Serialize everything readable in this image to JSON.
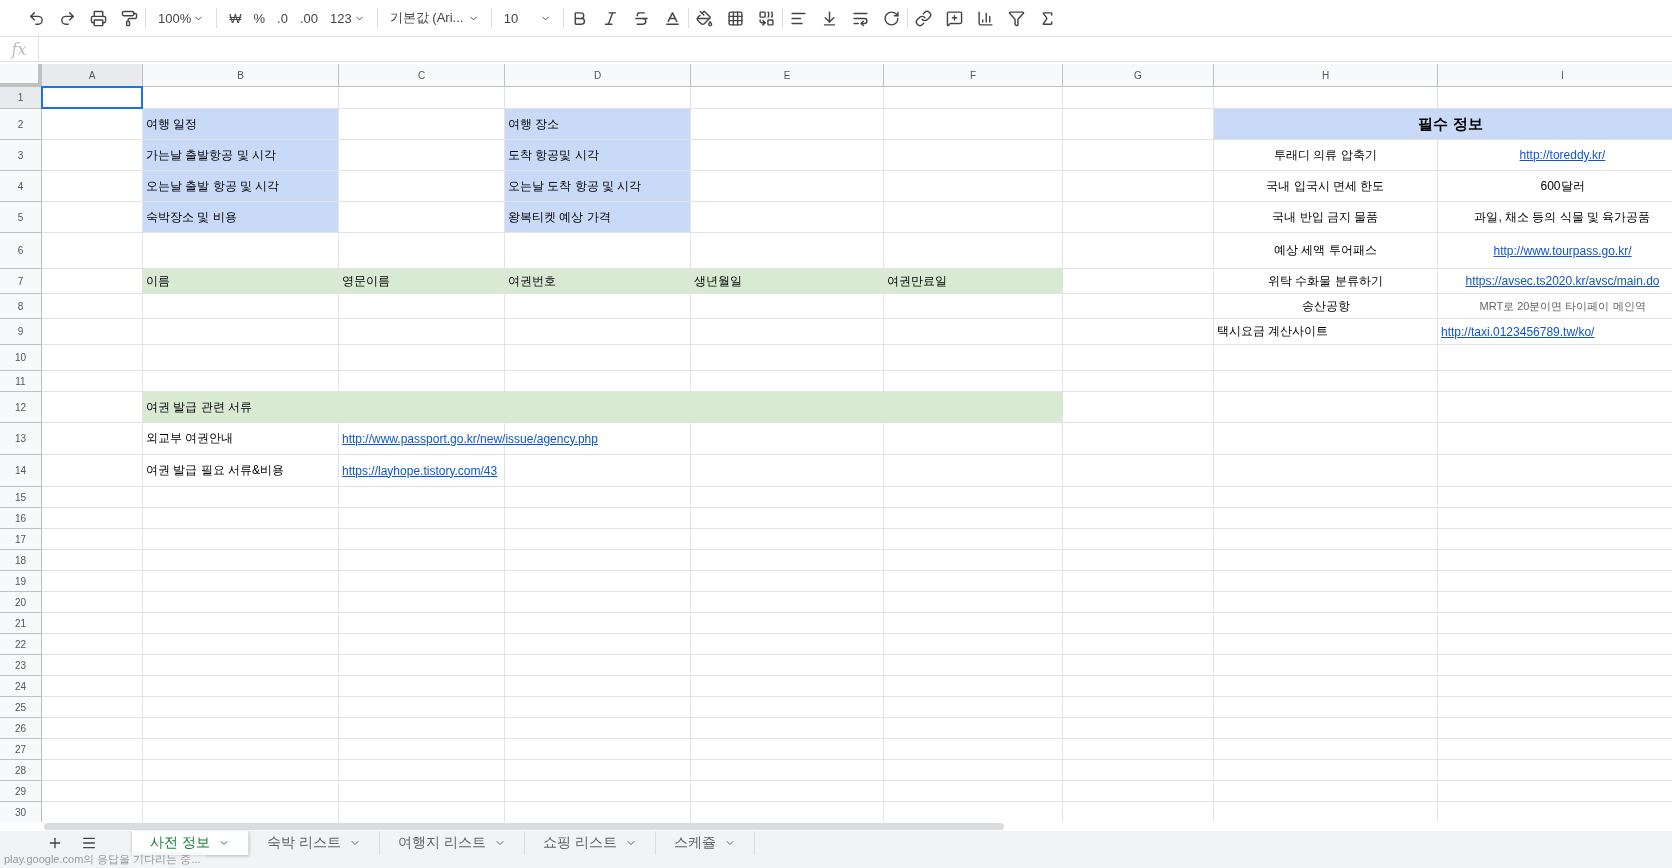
{
  "toolbar": {
    "zoom": "100%",
    "currency": "₩",
    "percent": "%",
    "decimal_less": ".0",
    "decimal_more": ".00",
    "number_format": "123",
    "font": "기본값 (Ari...",
    "font_size": "10"
  },
  "formula_bar": {
    "label": "fx"
  },
  "columns": [
    {
      "label": "A",
      "selected": true
    },
    {
      "label": "B",
      "selected": false
    },
    {
      "label": "C",
      "selected": false
    },
    {
      "label": "D",
      "selected": false
    },
    {
      "label": "E",
      "selected": false
    },
    {
      "label": "F",
      "selected": false
    },
    {
      "label": "G",
      "selected": false
    },
    {
      "label": "H",
      "selected": false
    },
    {
      "label": "I",
      "selected": false
    }
  ],
  "rows": [
    {
      "number": "1",
      "selected": true,
      "cells": {}
    },
    {
      "number": "2",
      "selected": false,
      "cells": {
        "b": {
          "text": "여행 일정",
          "color": "#c9daf8"
        },
        "d": {
          "text": "여행 장소",
          "color": "#c9daf8"
        },
        "h": {
          "text": "필수 정보",
          "color": "#c9daf8",
          "kind": "title",
          "centered": true
        },
        "i": {
          "kind": "covered",
          "color": "#c9daf8"
        }
      }
    },
    {
      "number": "3",
      "selected": false,
      "cells": {
        "b": {
          "text": "가는날 출발항공 및 시각",
          "color": "#c9daf8"
        },
        "d": {
          "text": "도착 항공및 시각",
          "color": "#c9daf8"
        },
        "h": {
          "text": "투래디 의류 압축기",
          "centered": true
        },
        "i": {
          "text": "http://toreddy.kr/",
          "kind": "link",
          "centered": true
        }
      }
    },
    {
      "number": "4",
      "selected": false,
      "cells": {
        "b": {
          "text": "오는날 출발 항공 및 시각",
          "color": "#c9daf8"
        },
        "d": {
          "text": "오는날 도착 항공 및 시각",
          "color": "#c9daf8"
        },
        "h": {
          "text": "국내 입국시 면세 한도",
          "centered": true
        },
        "i": {
          "text": "600달러",
          "centered": true
        }
      }
    },
    {
      "number": "5",
      "selected": false,
      "cells": {
        "b": {
          "text": "숙박장소 및 비용",
          "color": "#c9daf8"
        },
        "d": {
          "text": "왕복티켓 예상 가격",
          "color": "#c9daf8"
        },
        "h": {
          "text": "국내 반입 금지 물품",
          "centered": true
        },
        "i": {
          "text": "과일, 채소 등의 식물 및 육가공품",
          "centered": true
        }
      }
    },
    {
      "number": "6",
      "selected": false,
      "cells": {
        "h": {
          "text": "예상 세액 투어패스",
          "centered": true
        },
        "i": {
          "text": "http://www.tourpass.go.kr/",
          "kind": "link",
          "centered": true
        }
      }
    },
    {
      "number": "7",
      "selected": false,
      "cells": {
        "b": {
          "text": "이름",
          "color": "#d9ead3"
        },
        "c": {
          "text": "영문이름",
          "color": "#d9ead3"
        },
        "d": {
          "text": "여권번호",
          "color": "#d9ead3"
        },
        "e": {
          "text": "생년월일",
          "color": "#d9ead3"
        },
        "f": {
          "text": "여권만료일",
          "color": "#d9ead3"
        },
        "h": {
          "text": "위탁 수화물 분류하기",
          "centered": true
        },
        "i": {
          "text": "https://avsec.ts2020.kr/avsc/main.do",
          "kind": "link",
          "centered": true
        }
      }
    },
    {
      "number": "8",
      "selected": false,
      "cells": {
        "h": {
          "text": "송산공항",
          "centered": true
        },
        "i": {
          "text": "MRT로 20분이면 타이페이 메인역",
          "kind": "note",
          "centered": true
        }
      }
    },
    {
      "number": "9",
      "selected": false,
      "cells": {
        "h": {
          "text": "택시요금 계산사이트",
          "centered": false
        },
        "i": {
          "text": "http://taxi.0123456789.tw/ko/",
          "kind": "link",
          "centered": false
        }
      }
    },
    {
      "number": "10",
      "selected": false,
      "cells": {}
    },
    {
      "number": "11",
      "selected": false,
      "cells": {}
    },
    {
      "number": "12",
      "selected": false,
      "cells": {
        "b": {
          "text": "여권 발급 관련 서류",
          "color": "#d9ead3"
        },
        "c": {
          "kind": "covered",
          "color": "#d9ead3"
        },
        "d": {
          "kind": "covered",
          "color": "#d9ead3"
        },
        "e": {
          "kind": "covered",
          "color": "#d9ead3"
        },
        "f": {
          "kind": "covered",
          "color": "#d9ead3"
        }
      }
    },
    {
      "number": "13",
      "selected": false,
      "cells": {
        "b": {
          "text": "외교부 여권안내"
        },
        "c": {
          "text": "http://www.passport.go.kr/new/issue/agency.php",
          "kind": "link"
        }
      }
    },
    {
      "number": "14",
      "selected": false,
      "cells": {
        "b": {
          "text": "여권 발급 필요 서류&비용"
        },
        "c": {
          "text": "https://layhope.tistory.com/43",
          "kind": "link"
        }
      }
    },
    {
      "number": "15",
      "selected": false,
      "cells": {}
    },
    {
      "number": "16",
      "selected": false,
      "cells": {}
    },
    {
      "number": "17",
      "selected": false,
      "cells": {}
    },
    {
      "number": "18",
      "selected": false,
      "cells": {}
    },
    {
      "number": "19",
      "selected": false,
      "cells": {}
    },
    {
      "number": "20",
      "selected": false,
      "cells": {}
    },
    {
      "number": "21",
      "selected": false,
      "cells": {}
    },
    {
      "number": "22",
      "selected": false,
      "cells": {}
    },
    {
      "number": "23",
      "selected": false,
      "cells": {}
    },
    {
      "number": "24",
      "selected": false,
      "cells": {}
    },
    {
      "number": "25",
      "selected": false,
      "cells": {}
    },
    {
      "number": "26",
      "selected": false,
      "cells": {}
    },
    {
      "number": "27",
      "selected": false,
      "cells": {}
    },
    {
      "number": "28",
      "selected": false,
      "cells": {}
    },
    {
      "number": "29",
      "selected": false,
      "cells": {}
    },
    {
      "number": "30",
      "selected": false,
      "cells": {}
    }
  ],
  "sheet_tabs": [
    {
      "label": "사전 정보",
      "selected": true
    },
    {
      "label": "숙박 리스트",
      "selected": false
    },
    {
      "label": "여행지 리스트",
      "selected": false
    },
    {
      "label": "쇼핑 리스트",
      "selected": false
    },
    {
      "label": "스케쥴",
      "selected": false
    }
  ],
  "status_text": "play.google.com의 응답을 기다리는 중..."
}
